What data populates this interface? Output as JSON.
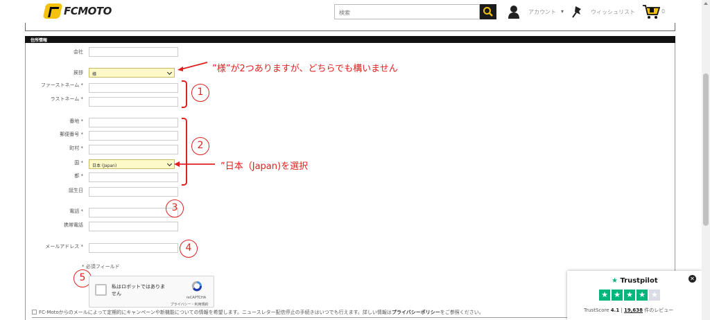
{
  "header": {
    "logo_text": "FCMOTO",
    "search_placeholder": "検索",
    "account_label": "アカウント",
    "account_caret": "▾",
    "wishlist_label": "ウィッシュリスト",
    "cart_count": "0"
  },
  "section": {
    "title": "住所情報"
  },
  "form": {
    "company_label": "会社",
    "salutation_label": "挨拶",
    "salutation_value": "様",
    "first_name_label": "ファーストネーム *",
    "last_name_label": "ラストネーム *",
    "street_label": "番地 *",
    "zip_label": "郵便番号 *",
    "city_label": "町村 *",
    "country_label": "国 *",
    "country_value": "日本 (Japan)",
    "prefecture_label": "都 *",
    "birthday_label": "誕生日",
    "phone_label": "電話 *",
    "mobile_label": "携帯電話",
    "email_label": "メールアドレス *",
    "required_note": "* 必須フィールド"
  },
  "annotations": {
    "note_salutation": "”様”が2つありますが、どちらでも構いません",
    "note_country": "”日本（Japan)を選択",
    "circle_1": "1",
    "circle_2": "2",
    "circle_3": "3",
    "circle_4": "4",
    "circle_5": "5"
  },
  "captcha": {
    "label": "私はロボットではありません",
    "brand": "reCAPTCHA",
    "links": "プライバシー・利用規約"
  },
  "newsletter": {
    "text_before": "FC-Motoからのメールによって定期的にキャンペーンや新機能についての情報を希望します。ニュースレター配信停止の手続きはいつでも行えます。詳しい情報は",
    "policy_link": "プライバシーポリシー",
    "text_after": "をご参照ください。"
  },
  "trustpilot": {
    "brand": "Trustpilot",
    "score_label": "TrustScore",
    "score": "4.1",
    "separator": "|",
    "reviews": "19,638",
    "reviews_suffix": "件のレビュー",
    "rating": 4,
    "rating_max": 5,
    "close": "✕"
  },
  "colors": {
    "accent_yellow": "#f4c20d",
    "annotation_red": "#e02020",
    "trust_green": "#00b67a",
    "select_bg": "#fef9c8"
  }
}
